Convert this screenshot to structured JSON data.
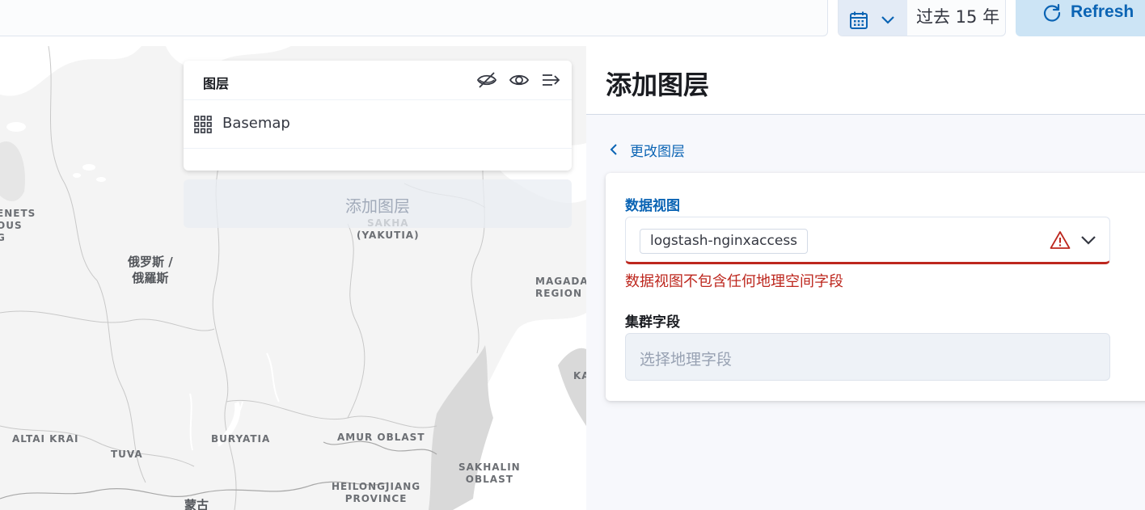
{
  "topbar": {
    "date_icon": "calendar-icon",
    "date_chevron_icon": "chevron-down-icon",
    "date_value": "过去 15 年",
    "refresh_icon": "refresh-icon",
    "refresh_label": "Refresh"
  },
  "map": {
    "labels": {
      "nenets": "ENETS\nOUS\nG",
      "sakha": "SAKHA\n(YAKUTIA)",
      "russia": "俄罗斯 /\n俄羅斯",
      "magadan": "MAGADAN\nREGION",
      "ka": "KA",
      "altai": "ALTAI KRAI",
      "tuva": "TUVA",
      "buryatia": "BURYATIA",
      "amur": "AMUR OBLAST",
      "sakhalin": "SAKHALIN\nOBLAST",
      "heilongjiang": "HEILONGJIANG\nPROVINCE",
      "mongolia": "蒙古"
    }
  },
  "layer_panel": {
    "title": "图层",
    "hide_all_icon": "eye-closed-icon",
    "show_all_icon": "eye-icon",
    "collapse_icon": "collapse-panel-icon",
    "layers": [
      {
        "name": "Basemap",
        "icon": "grid-icon"
      }
    ],
    "add_layer_label": "添加图层"
  },
  "flyout": {
    "title": "添加图层",
    "back_label": "更改图层",
    "back_icon": "chevron-left-icon",
    "data_view_label": "数据视图",
    "data_view_value": "logstash-nginxaccess",
    "warning_icon": "warning-icon",
    "dropdown_icon": "chevron-down-icon",
    "error_text": "数据视图不包含任何地理空间字段",
    "cluster_field_label": "集群字段",
    "geo_field_placeholder": "选择地理字段"
  },
  "colors": {
    "accent": "#0b64b4",
    "error": "#bd271e",
    "refresh_bg": "#cce4f5"
  }
}
